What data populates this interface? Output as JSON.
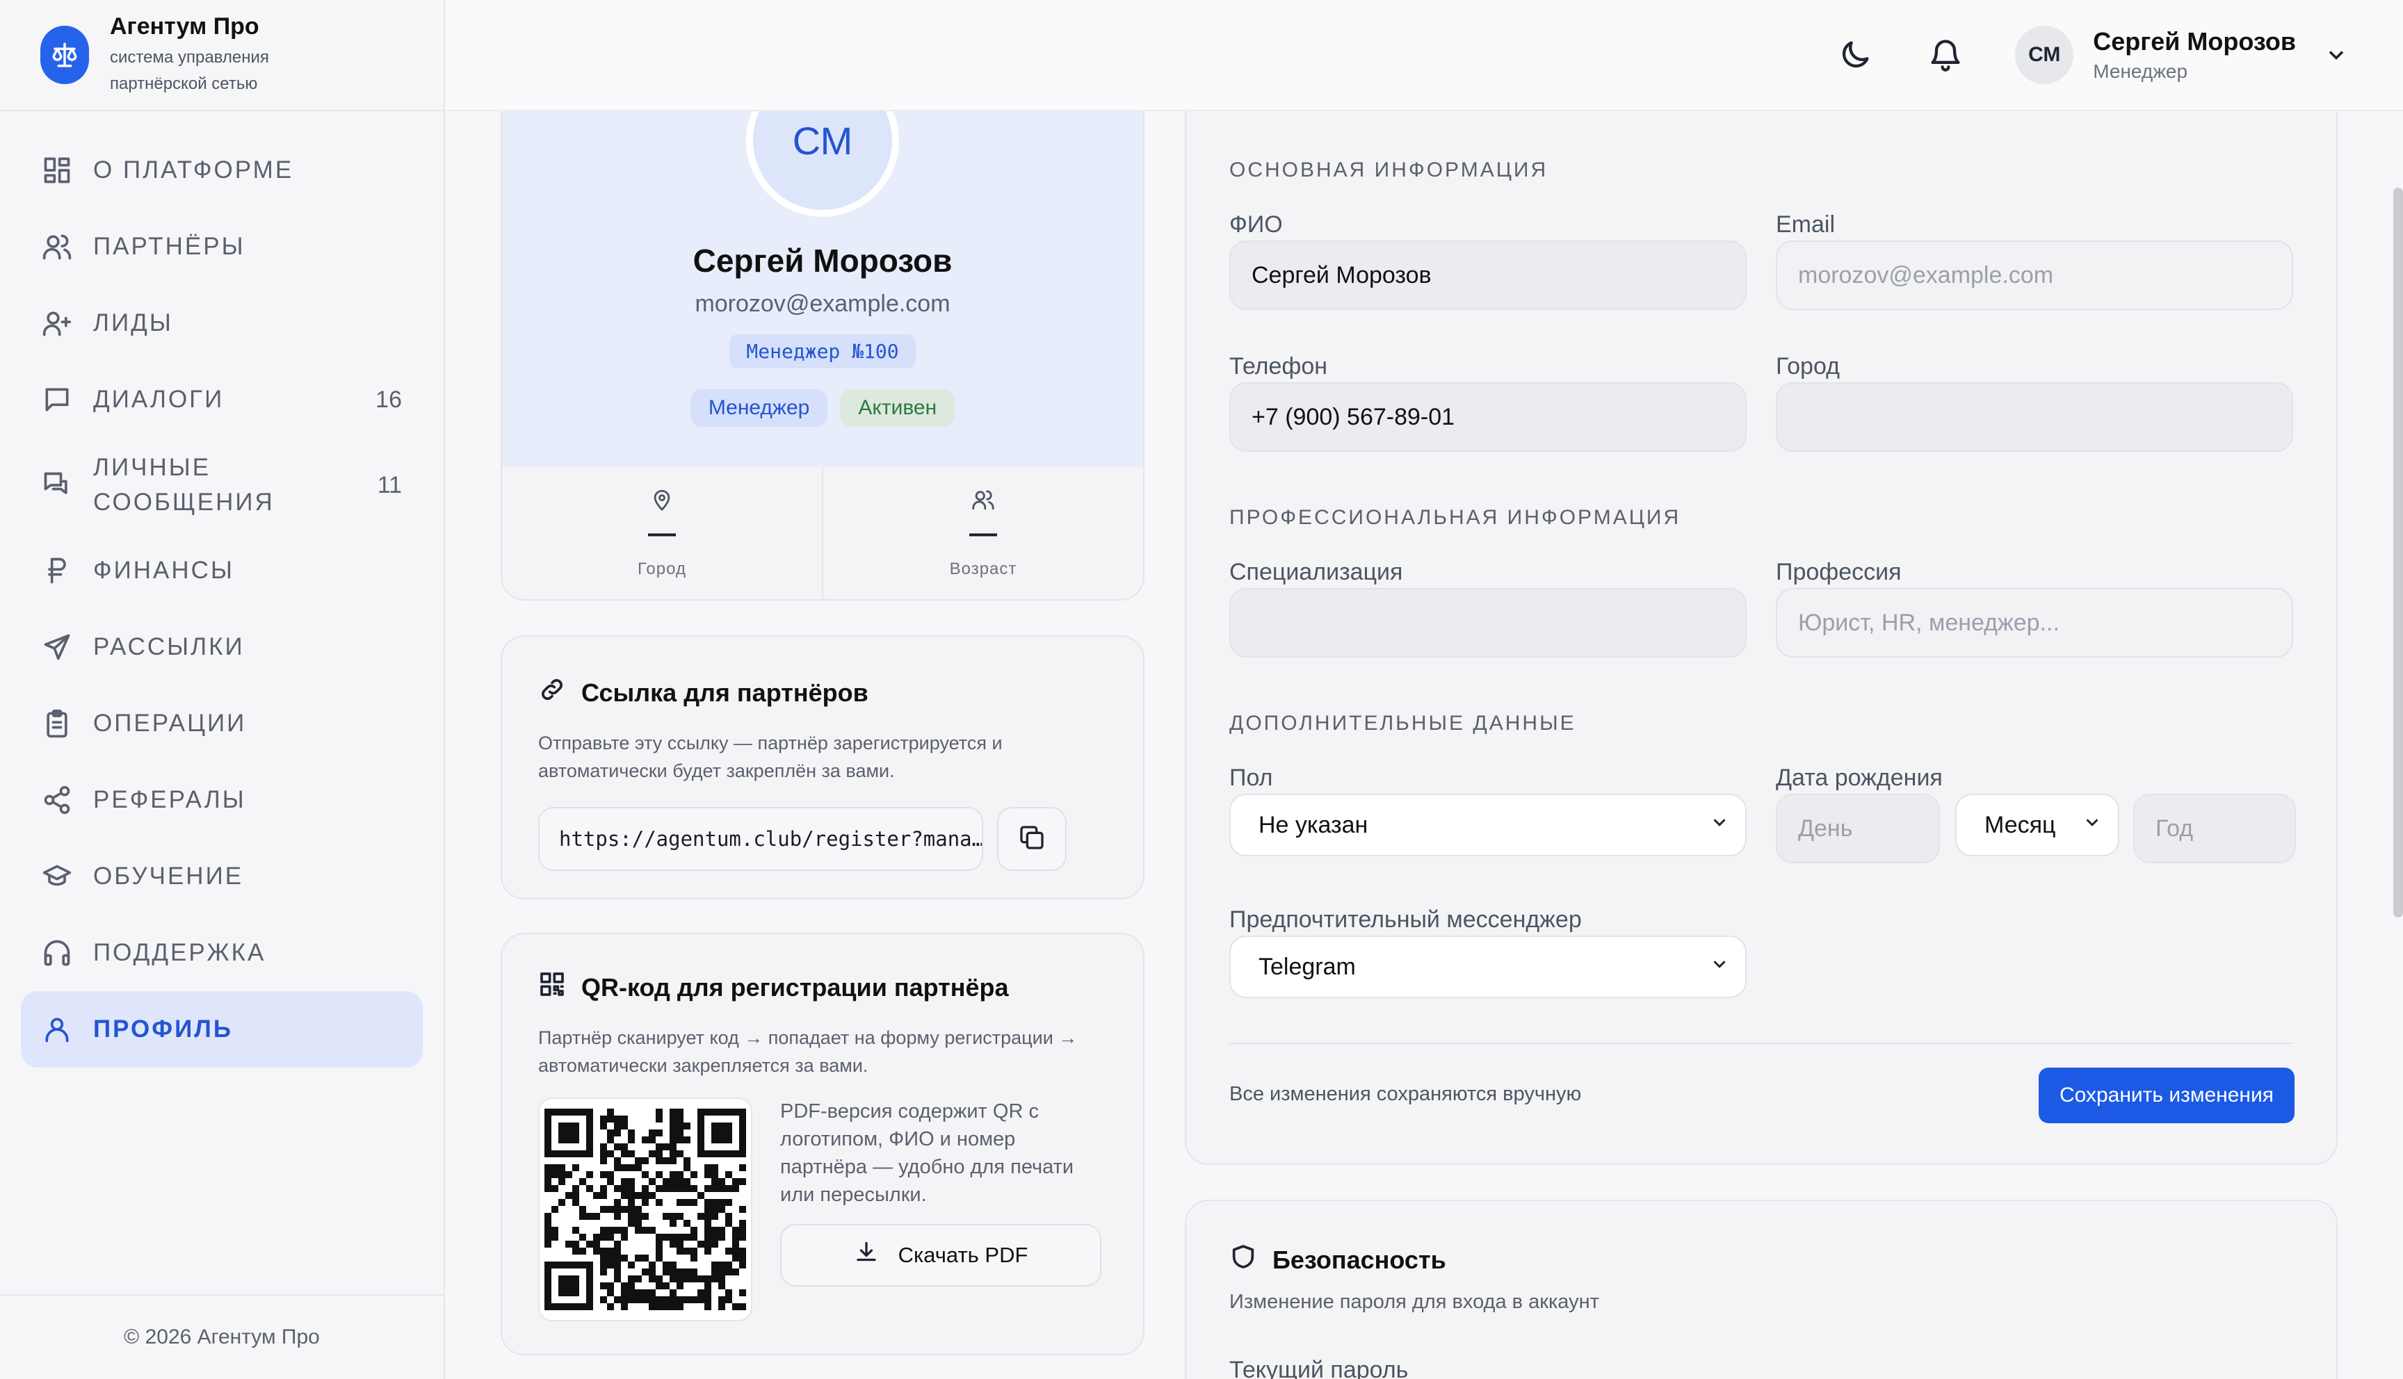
{
  "brand": {
    "name": "Агентум Про",
    "subtitle": "система управления партнёрской сетью"
  },
  "sidebar": {
    "items": [
      {
        "label": "О ПЛАТФОРМЕ",
        "icon": "grid-icon"
      },
      {
        "label": "ПАРТНЁРЫ",
        "icon": "users-icon"
      },
      {
        "label": "ЛИДЫ",
        "icon": "user-plus-icon"
      },
      {
        "label": "ДИАЛОГИ",
        "icon": "message-square-icon",
        "count": "16"
      },
      {
        "label": "ЛИЧНЫЕ СООБЩЕНИЯ",
        "icon": "messages-icon",
        "count": "11"
      },
      {
        "label": "ФИНАНСЫ",
        "icon": "ruble-icon"
      },
      {
        "label": "РАССЫЛКИ",
        "icon": "send-icon"
      },
      {
        "label": "ОПЕРАЦИИ",
        "icon": "clipboard-icon"
      },
      {
        "label": "РЕФЕРАЛЫ",
        "icon": "share-icon"
      },
      {
        "label": "ОБУЧЕНИЕ",
        "icon": "graduation-cap-icon"
      },
      {
        "label": "ПОДДЕРЖКА",
        "icon": "headphones-icon"
      },
      {
        "label": "ПРОФИЛЬ",
        "icon": "user-icon",
        "active": true
      }
    ],
    "footer": "© 2026 Агентум Про"
  },
  "topbar": {
    "avatar_initials": "СМ",
    "user_name": "Сергей Морозов",
    "user_role": "Менеджер"
  },
  "profile": {
    "initials": "СМ",
    "name": "Сергей Морозов",
    "email": "morozov@example.com",
    "code": "Менеджер №100",
    "role_badge": "Менеджер",
    "status_badge": "Активен",
    "stats": [
      {
        "value": "—",
        "label": "Город"
      },
      {
        "value": "—",
        "label": "Возраст"
      }
    ]
  },
  "partner_link": {
    "title": "Ссылка для партнёров",
    "description": "Отправьте эту ссылку — партнёр зарегистрируется и автоматически будет закреплён за вами.",
    "url": "https://agentum.club/register?mana…"
  },
  "qr": {
    "title": "QR-код для регистрации партнёра",
    "description": "Партнёр сканирует код → попадает на форму регистрации → автоматически закрепляется за вами.",
    "pdf_text": "PDF-версия содержит QR с логотипом, ФИО и номер партнёра — удобно для печати или пересылки.",
    "pdf_button": "Скачать PDF"
  },
  "form": {
    "section_basic": "ОСНОВНАЯ ИНФОРМАЦИЯ",
    "fio_label": "ФИО",
    "fio_value": "Сергей Морозов",
    "email_label": "Email",
    "email_placeholder": "morozov@example.com",
    "phone_label": "Телефон",
    "phone_value": "+7 (900) 567-89-01",
    "city_label": "Город",
    "city_value": "",
    "section_prof": "ПРОФЕССИОНАЛЬНАЯ ИНФОРМАЦИЯ",
    "spec_label": "Специализация",
    "spec_value": "",
    "prof_label": "Профессия",
    "prof_placeholder": "Юрист, HR, менеджер...",
    "section_extra": "ДОПОЛНИТЕЛЬНЫЕ ДАННЫЕ",
    "gender_label": "Пол",
    "gender_value": "Не указан",
    "birth_label": "Дата рождения",
    "day_placeholder": "День",
    "month_value": "Месяц",
    "year_placeholder": "Год",
    "messenger_label": "Предпочтительный мессенджер",
    "messenger_value": "Telegram",
    "save_note": "Все изменения сохраняются вручную",
    "save_button": "Сохранить изменения"
  },
  "security": {
    "title": "Безопасность",
    "description": "Изменение пароля для входа в аккаунт",
    "current_password_label": "Текущий пароль"
  },
  "colors": {
    "accent": "#2354d1",
    "primary_button": "#1c5ae6",
    "active_nav_bg": "#dfe6fb",
    "status_green": "#2b7a3b"
  }
}
